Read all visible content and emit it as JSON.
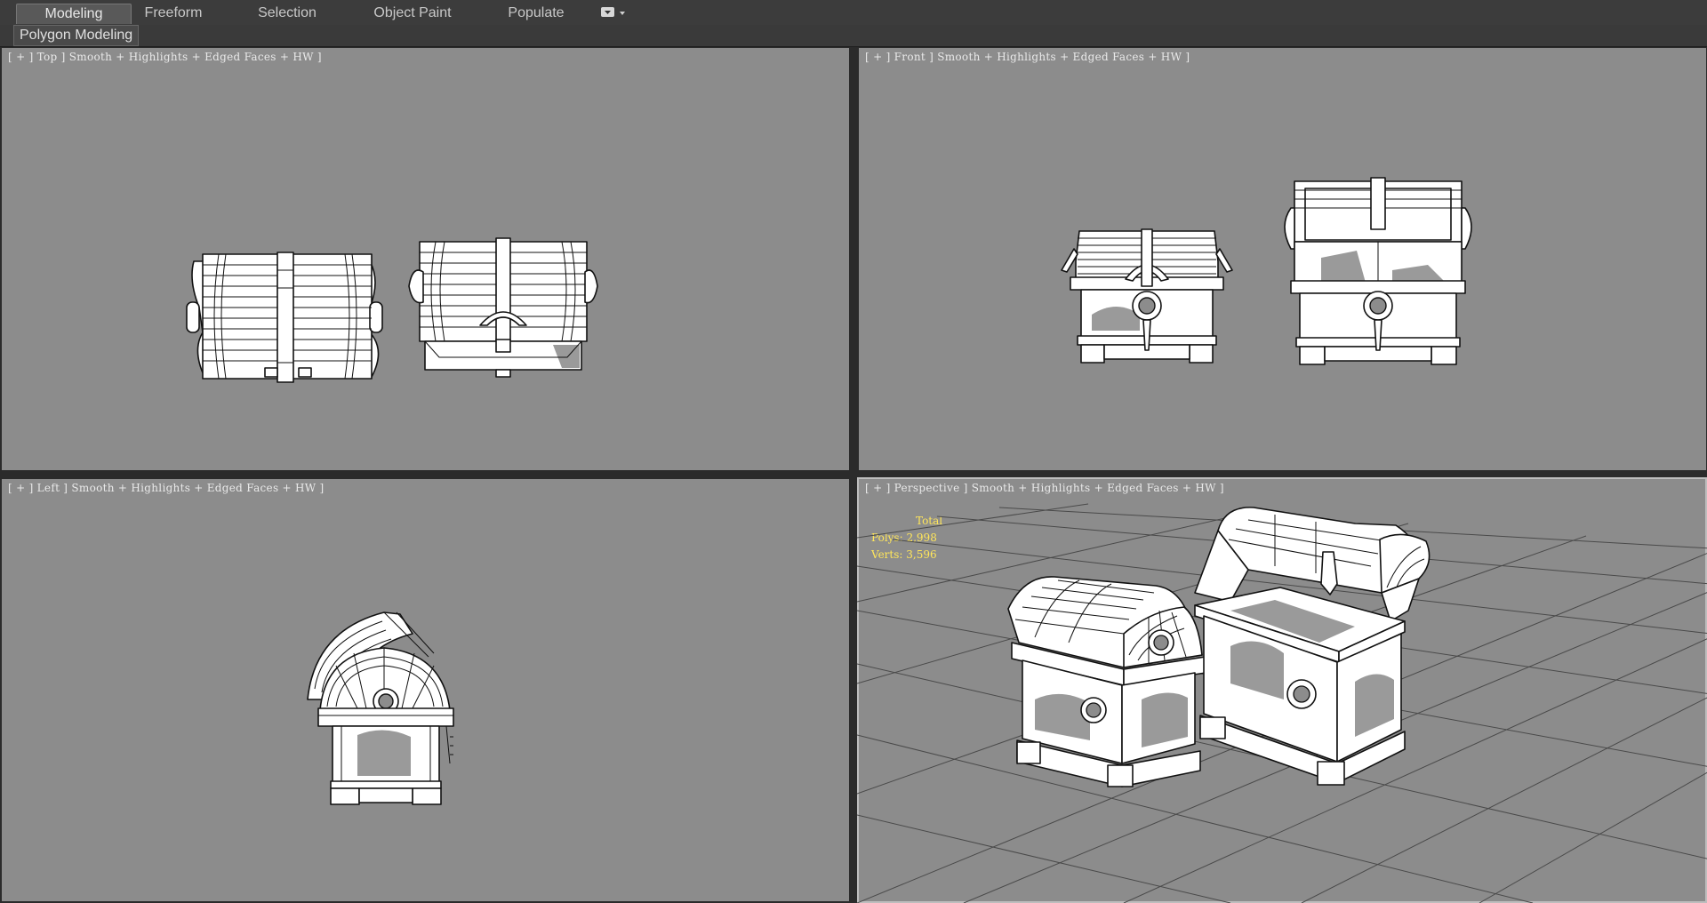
{
  "ribbon": {
    "tabs": [
      {
        "label": "Modeling"
      },
      {
        "label": "Freeform"
      },
      {
        "label": "Selection"
      },
      {
        "label": "Object Paint"
      },
      {
        "label": "Populate"
      }
    ]
  },
  "panel": {
    "label": "Polygon Modeling"
  },
  "viewports": {
    "top": {
      "label": "[ + ] Top ] Smooth + Highlights + Edged Faces + HW ]"
    },
    "front": {
      "label": "[ + ] Front ] Smooth + Highlights + Edged Faces + HW ]"
    },
    "left": {
      "label": "[ + ] Left ] Smooth + Highlights + Edged Faces + HW ]"
    },
    "perspective": {
      "label": "[ + ] Perspective ] Smooth + Highlights + Edged Faces + HW ]",
      "stats": {
        "total": "Total",
        "polys_label": "Polys:",
        "polys": "2,998",
        "verts_label": "Verts:",
        "verts": "3,596"
      }
    }
  },
  "colors": {
    "viewport_bg": "#8c8c8c",
    "stats_text": "#ffe65a",
    "ribbon_bg": "#3c3c3c"
  }
}
